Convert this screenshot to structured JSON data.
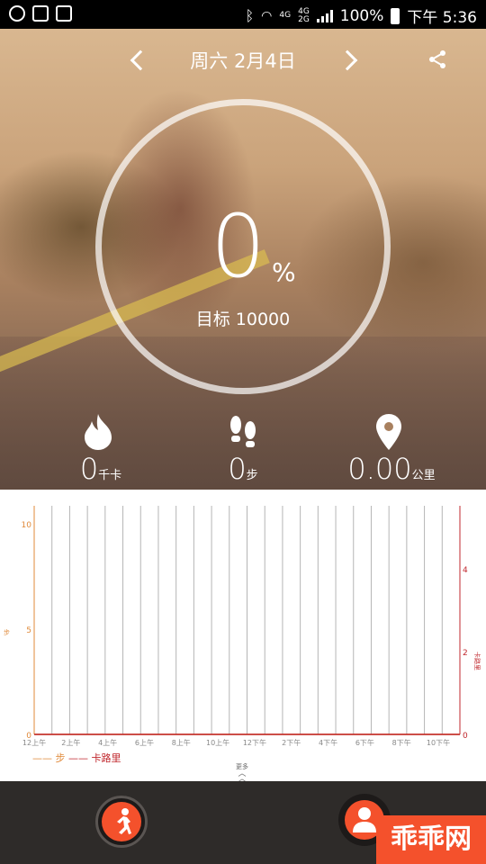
{
  "status_bar": {
    "network_top": "4G",
    "network_sub_top": "4G",
    "network_sub_bottom": "2G",
    "battery": "100%",
    "time": "下午 5:36"
  },
  "header": {
    "date": "周六  2月4日",
    "share_icon": "share-icon"
  },
  "progress": {
    "percent": "0",
    "percent_sign": "%",
    "goal": "目标 10000"
  },
  "stats": [
    {
      "icon": "flame-icon",
      "value": "0",
      "unit": "千卡"
    },
    {
      "icon": "footprints-icon",
      "value": "0",
      "unit": "步"
    },
    {
      "icon": "location-pin-icon",
      "value": "0.00",
      "unit": "公里"
    }
  ],
  "chart_data": {
    "type": "line",
    "x": [
      "12上午",
      "2上午",
      "4上午",
      "6上午",
      "8上午",
      "10上午",
      "12下午",
      "2下午",
      "4下午",
      "6下午",
      "8下午",
      "10下午"
    ],
    "series": [
      {
        "name": "步",
        "values": [
          0,
          0,
          0,
          0,
          0,
          0,
          0,
          0,
          0,
          0,
          0,
          0
        ],
        "color": "#e08a3a"
      },
      {
        "name": "卡路里",
        "values": [
          0,
          0,
          0,
          0,
          0,
          0,
          0,
          0,
          0,
          0,
          0,
          0
        ],
        "color": "#c0272d"
      }
    ],
    "y_left_ticks": [
      "10",
      "5",
      "0"
    ],
    "y_right_ticks": [
      "4",
      "2",
      "0"
    ],
    "ylim_left": [
      0,
      10
    ],
    "ylim_right": [
      0,
      4
    ],
    "ylabel_left": "步",
    "ylabel_right": "卡路里",
    "grid": true,
    "legend_position": "bottom-left",
    "more_label": "更多"
  },
  "bottom_bar": {
    "run_icon": "runner-icon",
    "profile_icon": "person-icon"
  },
  "watermark": "乖乖网",
  "colors": {
    "accent": "#f4512c",
    "steps": "#e08a3a",
    "calories": "#c0272d",
    "bottom_bar": "#2e2b29"
  }
}
